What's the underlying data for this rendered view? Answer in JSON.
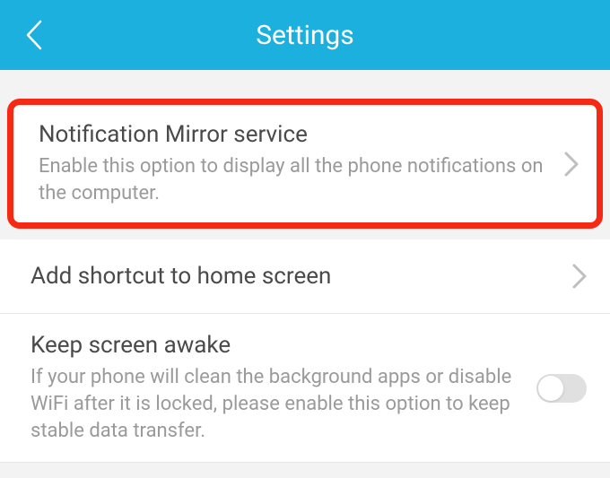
{
  "header": {
    "title": "Settings"
  },
  "items": [
    {
      "title": "Notification Mirror service",
      "subtitle": "Enable this option to display all the phone notifications on the computer."
    },
    {
      "title": "Add shortcut to home screen"
    },
    {
      "title": "Keep screen awake",
      "subtitle": "If your phone will clean the background apps or disable WiFi after it is locked, please enable this option to keep stable data transfer."
    }
  ]
}
